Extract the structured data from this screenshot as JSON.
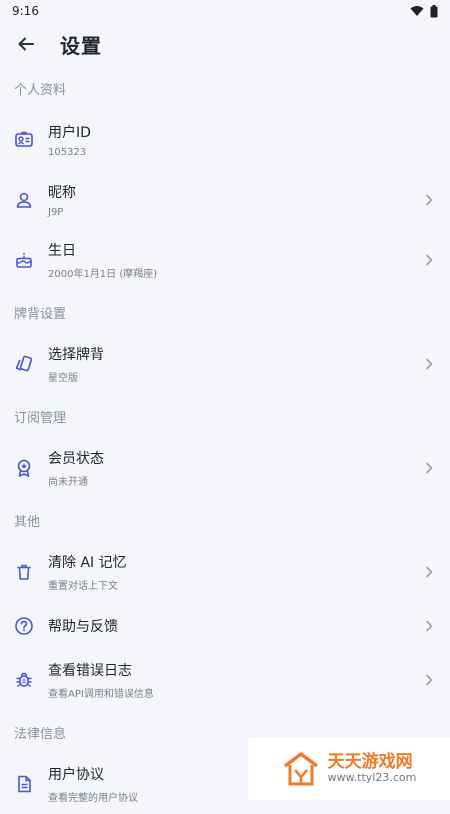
{
  "status": {
    "time": "9:16"
  },
  "header": {
    "title": "设置"
  },
  "sections": [
    {
      "label": "个人资料",
      "items": [
        {
          "title": "用户ID",
          "subtitle": "105323",
          "icon": "id-card-icon",
          "chevron": false
        },
        {
          "title": "昵称",
          "subtitle": "J9P",
          "icon": "person-icon",
          "chevron": true
        },
        {
          "title": "生日",
          "subtitle": "2000年1月1日 (摩羯座)",
          "icon": "cake-icon",
          "chevron": true
        }
      ]
    },
    {
      "label": "牌背设置",
      "items": [
        {
          "title": "选择牌背",
          "subtitle": "星空版",
          "icon": "cards-icon",
          "chevron": true
        }
      ]
    },
    {
      "label": "订阅管理",
      "items": [
        {
          "title": "会员状态",
          "subtitle": "尚未开通",
          "icon": "badge-icon",
          "chevron": true
        }
      ]
    },
    {
      "label": "其他",
      "items": [
        {
          "title": "清除 AI 记忆",
          "subtitle": "重置对话上下文",
          "icon": "trash-icon",
          "chevron": true
        },
        {
          "title": "帮助与反馈",
          "subtitle": "",
          "icon": "help-icon",
          "chevron": true
        },
        {
          "title": "查看错误日志",
          "subtitle": "查看API调用和错误信息",
          "icon": "bug-icon",
          "chevron": true
        }
      ]
    },
    {
      "label": "法律信息",
      "items": [
        {
          "title": "用户协议",
          "subtitle": "查看完整的用户协议",
          "icon": "document-icon",
          "chevron": false
        }
      ]
    }
  ],
  "watermark": {
    "title": "天天游戏网",
    "url": "www.ttyl23.com"
  }
}
